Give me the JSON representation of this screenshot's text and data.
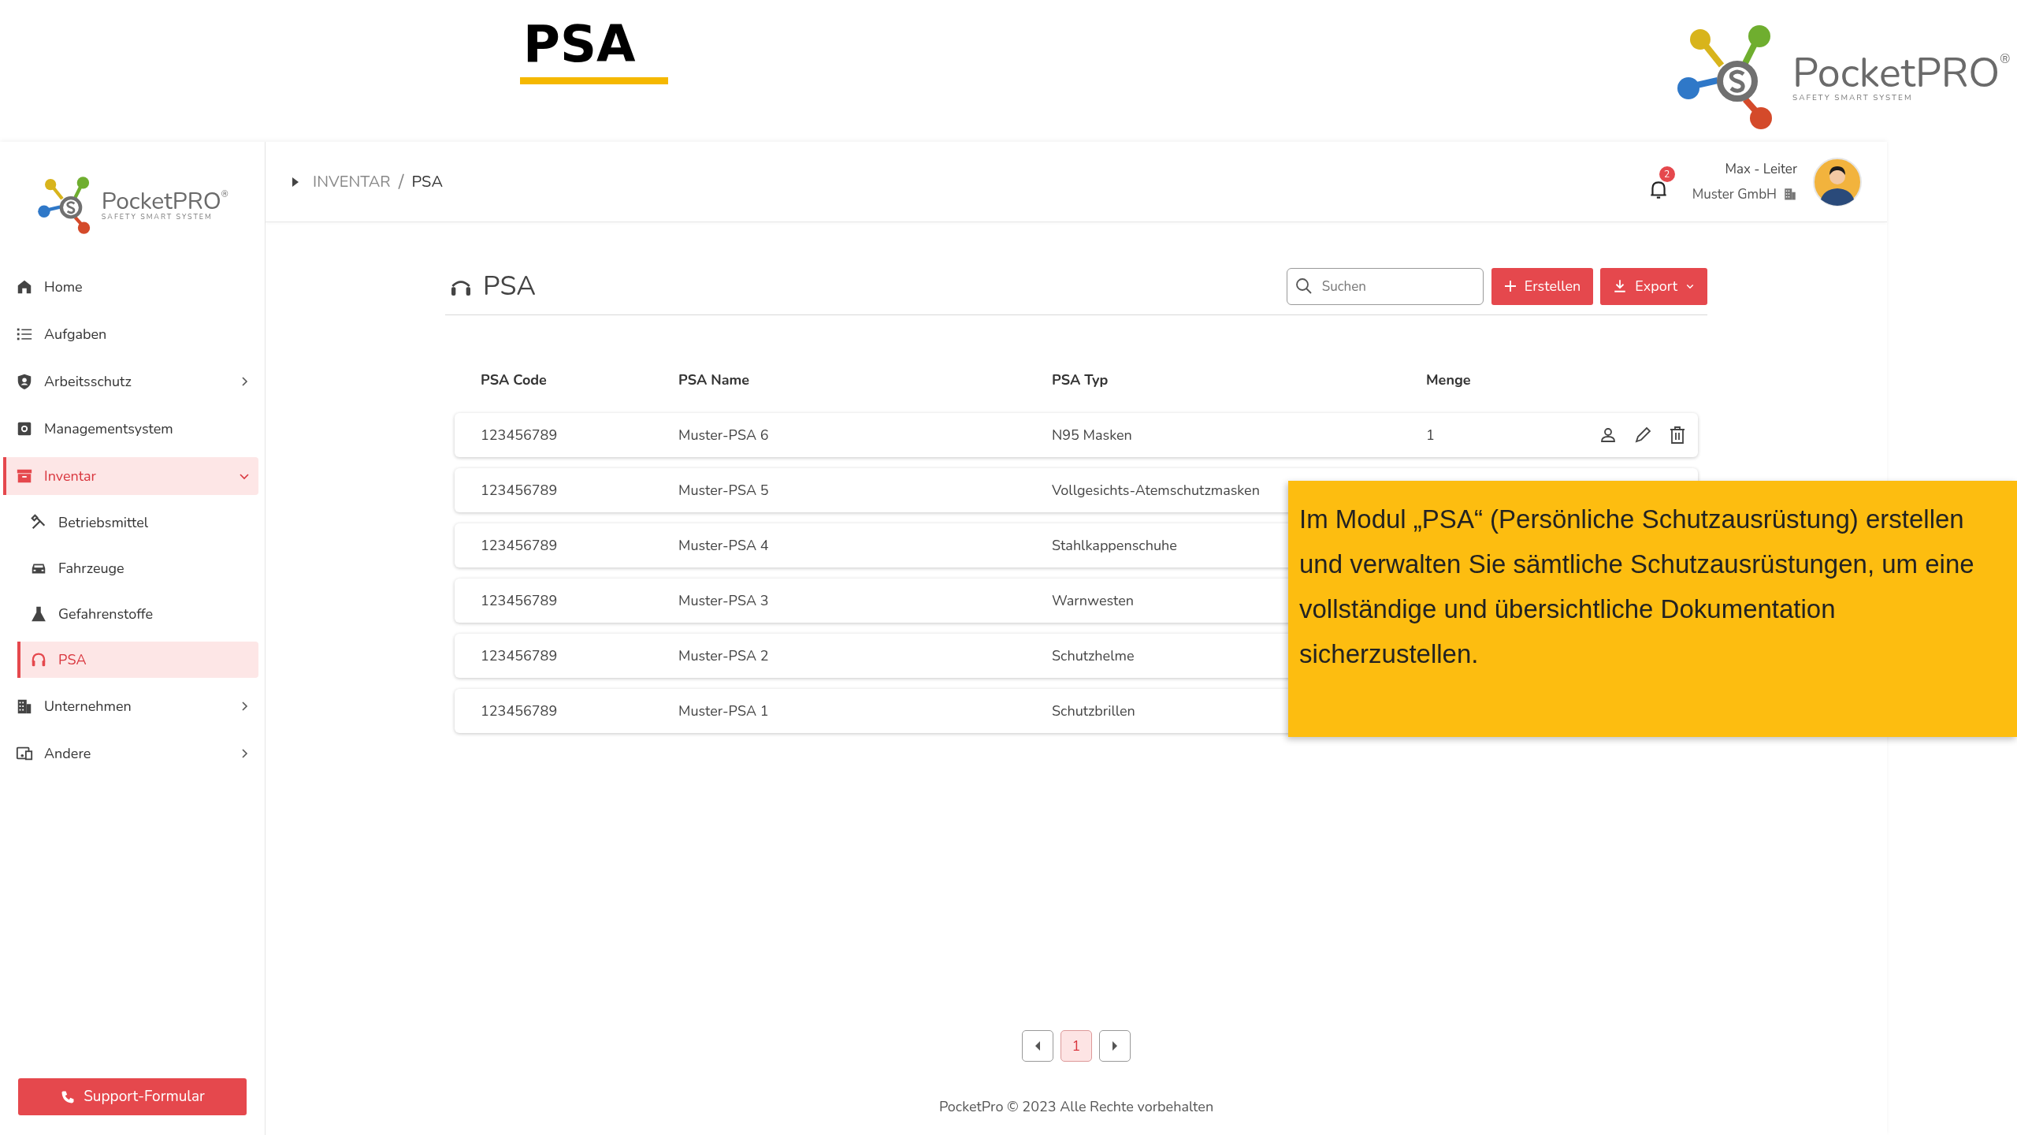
{
  "page_title": "PSA",
  "top_logo": {
    "name": "PocketPRO",
    "registered": "®",
    "tagline": "SAFETY SMART SYSTEM"
  },
  "sidebar": {
    "logo": {
      "name": "PocketPRO",
      "registered": "®",
      "tagline": "SAFETY SMART SYSTEM"
    },
    "items": [
      {
        "label": "Home",
        "selected": false
      },
      {
        "label": "Aufgaben",
        "selected": false
      },
      {
        "label": "Arbeitsschutz",
        "selected": false,
        "expanded": false
      },
      {
        "label": "Managementsystem",
        "selected": false
      },
      {
        "label": "Inventar",
        "selected": true,
        "expanded": true,
        "children": [
          {
            "label": "Betriebsmittel",
            "selected": false
          },
          {
            "label": "Fahrzeuge",
            "selected": false
          },
          {
            "label": "Gefahrenstoffe",
            "selected": false
          },
          {
            "label": "PSA",
            "selected": true
          }
        ]
      },
      {
        "label": "Unternehmen",
        "selected": false,
        "expanded": false
      },
      {
        "label": "Andere",
        "selected": false,
        "expanded": false
      }
    ],
    "support_button": "Support-Formular"
  },
  "breadcrumb": {
    "items": [
      "INVENTAR",
      "PSA"
    ],
    "separator": "/"
  },
  "header": {
    "notifications": "2",
    "user_name": "Max - Leiter",
    "company": "Muster GmbH"
  },
  "content": {
    "title": "PSA",
    "search": {
      "placeholder": "Suchen"
    },
    "buttons": [
      {
        "kind": "create",
        "label": "Erstellen"
      },
      {
        "kind": "export",
        "label": "Export"
      }
    ]
  },
  "table": {
    "columns": [
      "PSA Code",
      "PSA Name",
      "PSA Typ",
      "Menge"
    ],
    "rows": [
      {
        "code": "123456789",
        "name": "Muster-PSA 6",
        "type": "N95 Masken",
        "quantity": "1",
        "actions": true
      },
      {
        "code": "123456789",
        "name": "Muster-PSA 5",
        "type": "Vollgesichts-Atemschutzmasken"
      },
      {
        "code": "123456789",
        "name": "Muster-PSA 4",
        "type": "Stahlkappenschuhe"
      },
      {
        "code": "123456789",
        "name": "Muster-PSA 3",
        "type": "Warnwesten"
      },
      {
        "code": "123456789",
        "name": "Muster-PSA 2",
        "type": "Schutzhelme"
      },
      {
        "code": "123456789",
        "name": "Muster-PSA 1",
        "type": "Schutzbrillen"
      }
    ]
  },
  "pagination": {
    "pages": [
      {
        "label": "1",
        "selected": true
      }
    ]
  },
  "footer": "PocketPro © 2023 Alle Rechte vorbehalten",
  "callout": "Im Modul „PSA“ (Persönliche Schutzausrüstung) erstellen und verwalten Sie sämtliche Schutzausrüstungen, um eine vollständige und übersichtliche Dokumentation sicherzustellen."
}
